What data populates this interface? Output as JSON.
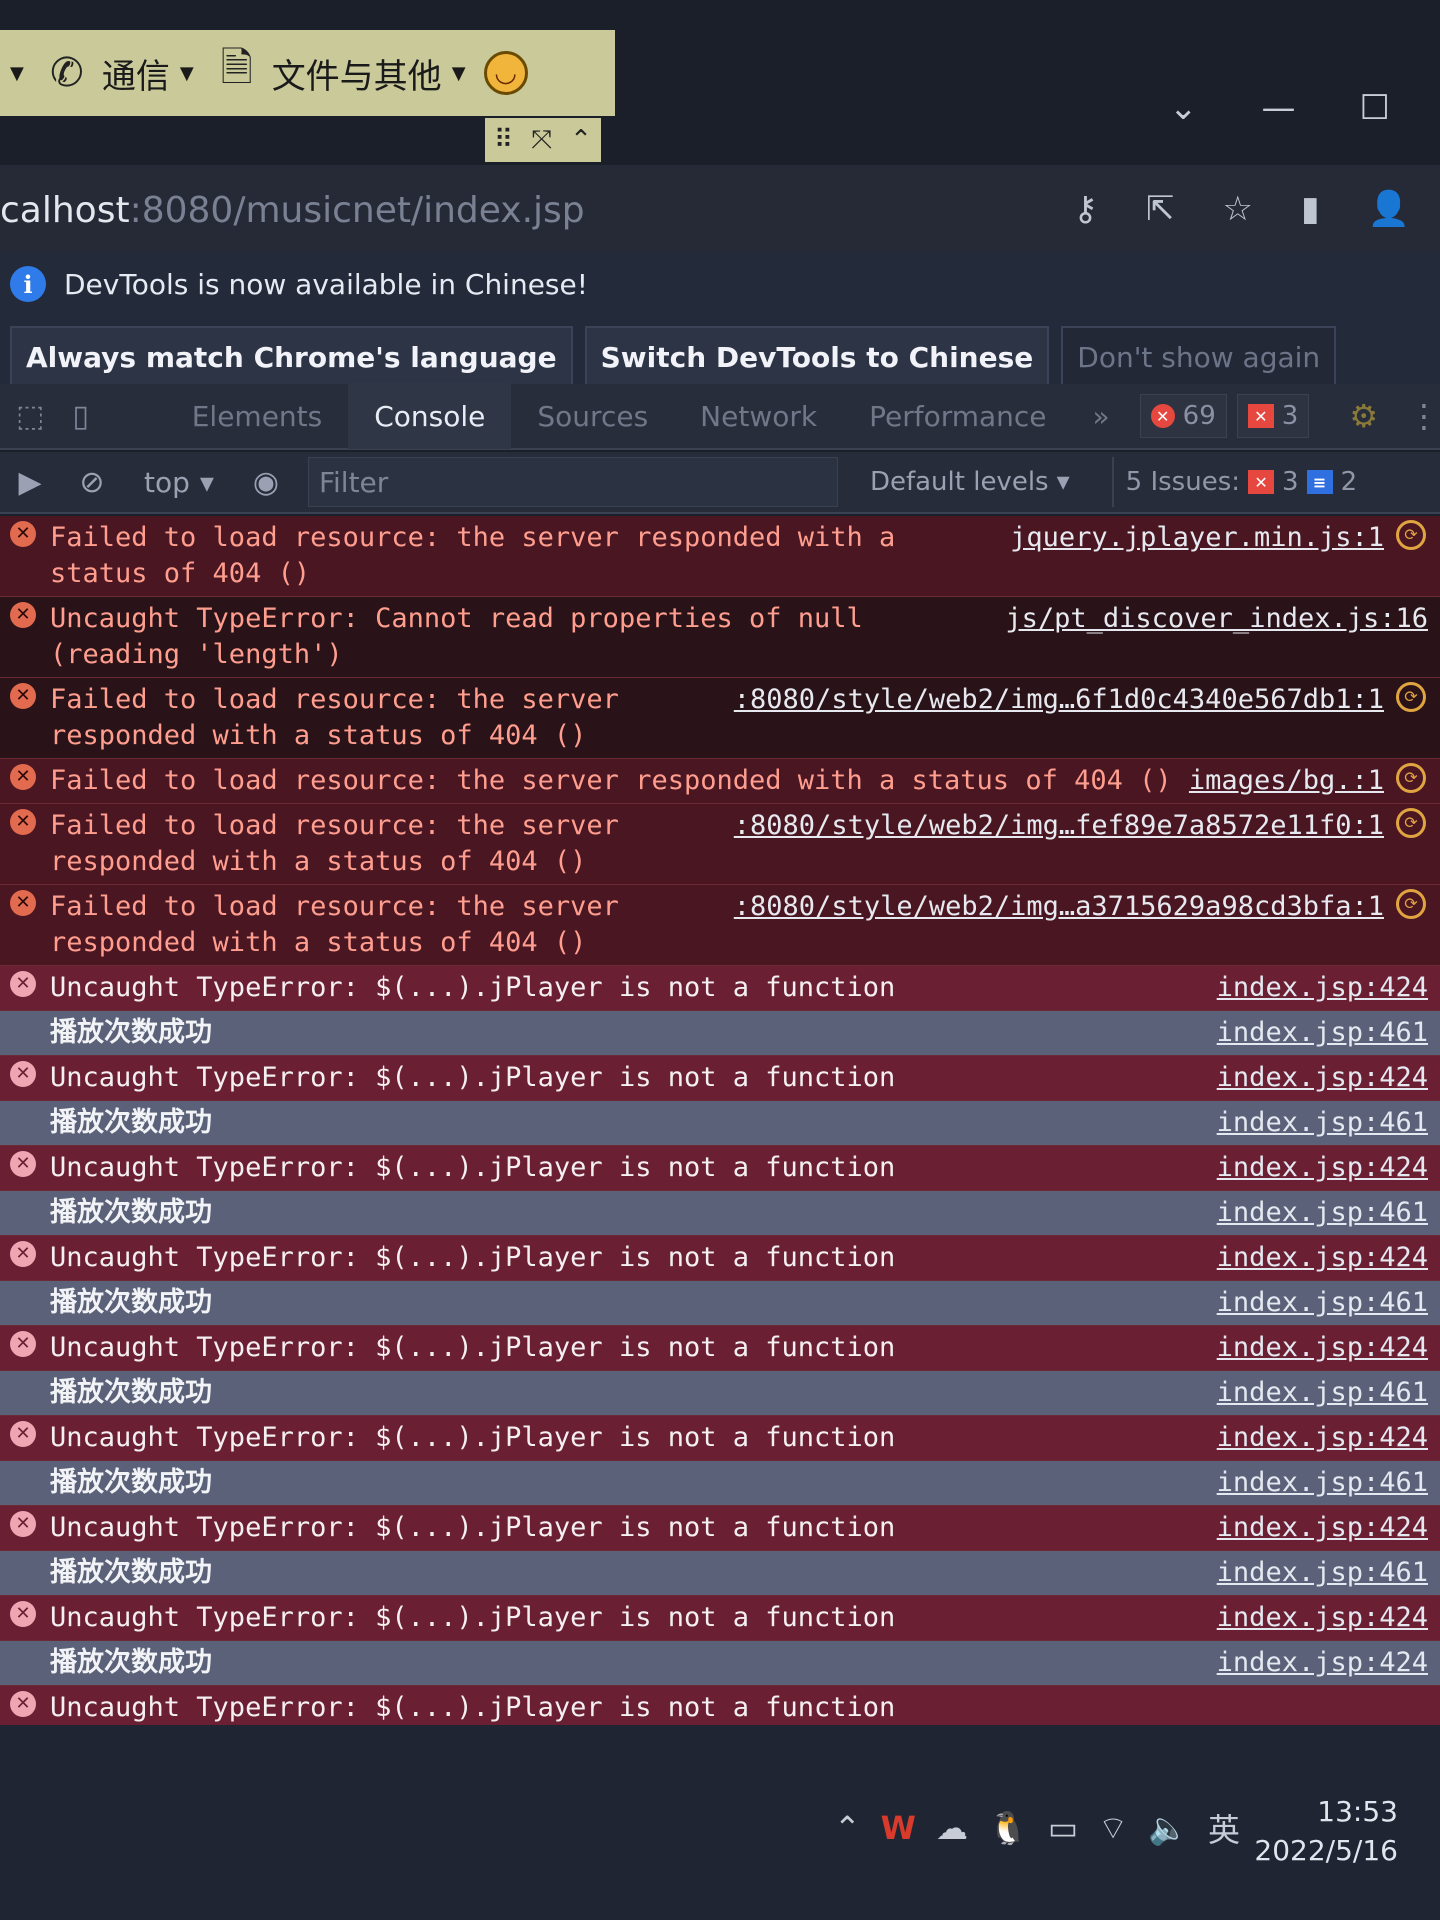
{
  "toolbar": {
    "comm_label": "通信",
    "files_label": "文件与其他"
  },
  "address": {
    "host": "calhost",
    "path": ":8080/musicnet/index.jsp"
  },
  "infobar": {
    "message": "DevTools is now available in Chinese!",
    "btn_match": "Always match Chrome's language",
    "btn_switch": "Switch DevTools to Chinese",
    "btn_dont": "Don't show again"
  },
  "tabs": [
    "Elements",
    "Console",
    "Sources",
    "Network",
    "Performance"
  ],
  "tab_more": "»",
  "badges": {
    "errors": "69",
    "warnings": "3"
  },
  "filter": {
    "context": "top",
    "placeholder": "Filter",
    "levels": "Default levels",
    "issues_label": "5 Issues:",
    "issues_error": "3",
    "issues_info": "2"
  },
  "rows": [
    {
      "type": "err",
      "msg": "Failed to load resource: the server responded with a status of 404 ()",
      "src": "jquery.jplayer.min.js:1",
      "icon": true
    },
    {
      "type": "err dark",
      "msg": "Uncaught TypeError: Cannot read properties of null (reading 'length')",
      "src": "js/pt_discover_index.js:16",
      "icon": false
    },
    {
      "type": "err dark",
      "msg": "Failed to load resource: the server\nresponded with a status of 404 ()",
      "src": ":8080/style/web2/img…6f1d0c4340e567db1:1",
      "icon": true
    },
    {
      "type": "err",
      "msg": "Failed to load resource: the server responded with a status of 404 ()",
      "src": "images/bg.:1",
      "icon": true
    },
    {
      "type": "err",
      "msg": "Failed to load resource: the server\nresponded with a status of 404 ()",
      "src": ":8080/style/web2/img…fef89e7a8572e11f0:1",
      "icon": true
    },
    {
      "type": "err",
      "msg": "Failed to load resource: the server\nresponded with a status of 404 ()",
      "src": ":8080/style/web2/img…a3715629a98cd3bfa:1",
      "icon": true
    },
    {
      "type": "err wine",
      "msg": "Uncaught TypeError: $(...).jPlayer is not a function",
      "src": "index.jsp:424",
      "icon": false
    },
    {
      "type": "log",
      "msg": "播放次数成功",
      "src": "index.jsp:461",
      "icon": false
    },
    {
      "type": "err wine",
      "msg": "Uncaught TypeError: $(...).jPlayer is not a function",
      "src": "index.jsp:424",
      "icon": false
    },
    {
      "type": "log",
      "msg": "播放次数成功",
      "src": "index.jsp:461",
      "icon": false
    },
    {
      "type": "err wine",
      "msg": "Uncaught TypeError: $(...).jPlayer is not a function",
      "src": "index.jsp:424",
      "icon": false
    },
    {
      "type": "log",
      "msg": "播放次数成功",
      "src": "index.jsp:461",
      "icon": false
    },
    {
      "type": "err wine",
      "msg": "Uncaught TypeError: $(...).jPlayer is not a function",
      "src": "index.jsp:424",
      "icon": false
    },
    {
      "type": "log",
      "msg": "播放次数成功",
      "src": "index.jsp:461",
      "icon": false
    },
    {
      "type": "err wine",
      "msg": "Uncaught TypeError: $(...).jPlayer is not a function",
      "src": "index.jsp:424",
      "icon": false
    },
    {
      "type": "log",
      "msg": "播放次数成功",
      "src": "index.jsp:461",
      "icon": false
    },
    {
      "type": "err wine",
      "msg": "Uncaught TypeError: $(...).jPlayer is not a function",
      "src": "index.jsp:424",
      "icon": false
    },
    {
      "type": "log",
      "msg": "播放次数成功",
      "src": "index.jsp:461",
      "icon": false
    },
    {
      "type": "err wine",
      "msg": "Uncaught TypeError: $(...).jPlayer is not a function",
      "src": "index.jsp:424",
      "icon": false
    },
    {
      "type": "log",
      "msg": "播放次数成功",
      "src": "index.jsp:461",
      "icon": false
    },
    {
      "type": "err wine",
      "msg": "Uncaught TypeError: $(...).jPlayer is not a function",
      "src": "index.jsp:424",
      "icon": false
    },
    {
      "type": "log",
      "msg": "播放次数成功",
      "src": "index.jsp:424",
      "icon": false
    },
    {
      "type": "err wine",
      "msg": "Uncaught TypeError: $(...).jPlayer is not a function",
      "src": "",
      "icon": false
    }
  ],
  "taskbar": {
    "time": "13:53",
    "date": "2022/5/16",
    "ime": "英"
  }
}
